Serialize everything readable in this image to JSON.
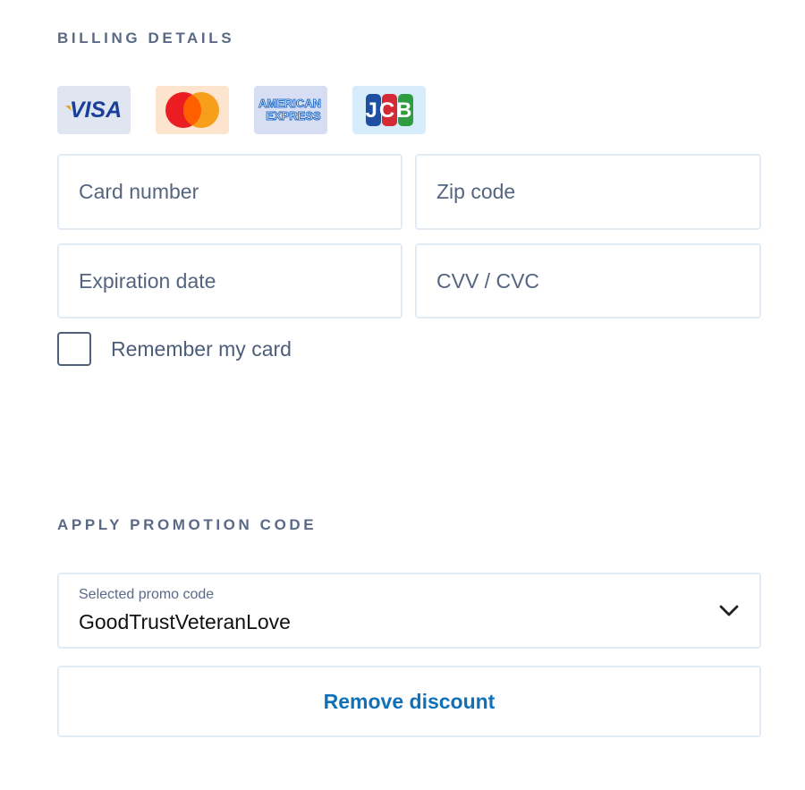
{
  "billing": {
    "heading": "BILLING DETAILS",
    "card_logos": [
      {
        "name": "visa",
        "text": "VISA",
        "bg": "#dfe6f2"
      },
      {
        "name": "mastercard",
        "bg": "#fde4cf"
      },
      {
        "name": "american-express",
        "text_line1": "AMERICAN",
        "text_line2": "EXPRESS",
        "bg": "#d7def3"
      },
      {
        "name": "jcb",
        "text": "JCB",
        "bg": "#d7ecfb"
      }
    ],
    "fields": {
      "card_number_placeholder": "Card number",
      "zip_code_placeholder": "Zip code",
      "expiration_placeholder": "Expiration date",
      "cvv_placeholder": "CVV / CVC"
    },
    "remember_label": "Remember my card",
    "remember_checked": false
  },
  "promo": {
    "heading": "APPLY PROMOTION CODE",
    "select_label": "Selected promo code",
    "selected_value": "GoodTrustVeteranLove",
    "remove_label": "Remove discount"
  },
  "colors": {
    "accent": "#1071b8",
    "heading": "#5a6a86",
    "border": "#e2ebf4"
  }
}
